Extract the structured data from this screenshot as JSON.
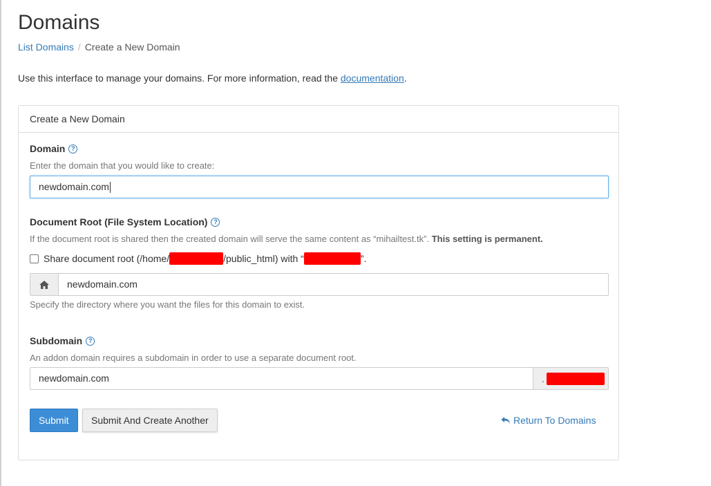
{
  "header": {
    "title": "Domains",
    "breadcrumb": {
      "link": "List Domains",
      "separator": "/",
      "current": "Create a New Domain"
    }
  },
  "intro": {
    "text": "Use this interface to manage your domains. For more information, read the",
    "link": "documentation",
    "suffix": "."
  },
  "panel": {
    "heading": "Create a New Domain",
    "domain": {
      "label": "Domain",
      "help": "Enter the domain that you would like to create:",
      "value": "newdomain.com"
    },
    "docroot": {
      "label": "Document Root (File System Location)",
      "help_prefix": "If the document root is shared then the created domain will serve the same content as “mihailtest.tk”.",
      "help_bold": "This setting is permanent.",
      "share_prefix": "Share document root (/home/",
      "share_middle": "/public_html) with “",
      "share_suffix": "”.",
      "share_checked": false,
      "icon": "home-icon",
      "value": "newdomain.com",
      "note": "Specify the directory where you want the files for this domain to exist."
    },
    "subdomain": {
      "label": "Subdomain",
      "help": "An addon domain requires a subdomain in order to use a separate document root.",
      "value": "newdomain.com",
      "suffix_dot": "."
    },
    "buttons": {
      "submit": "Submit",
      "submit_another": "Submit And Create Another",
      "return": "Return To Domains"
    }
  },
  "colors": {
    "link": "#337ab7",
    "primary": "#3c8dd6",
    "redaction": "#ff0000"
  }
}
